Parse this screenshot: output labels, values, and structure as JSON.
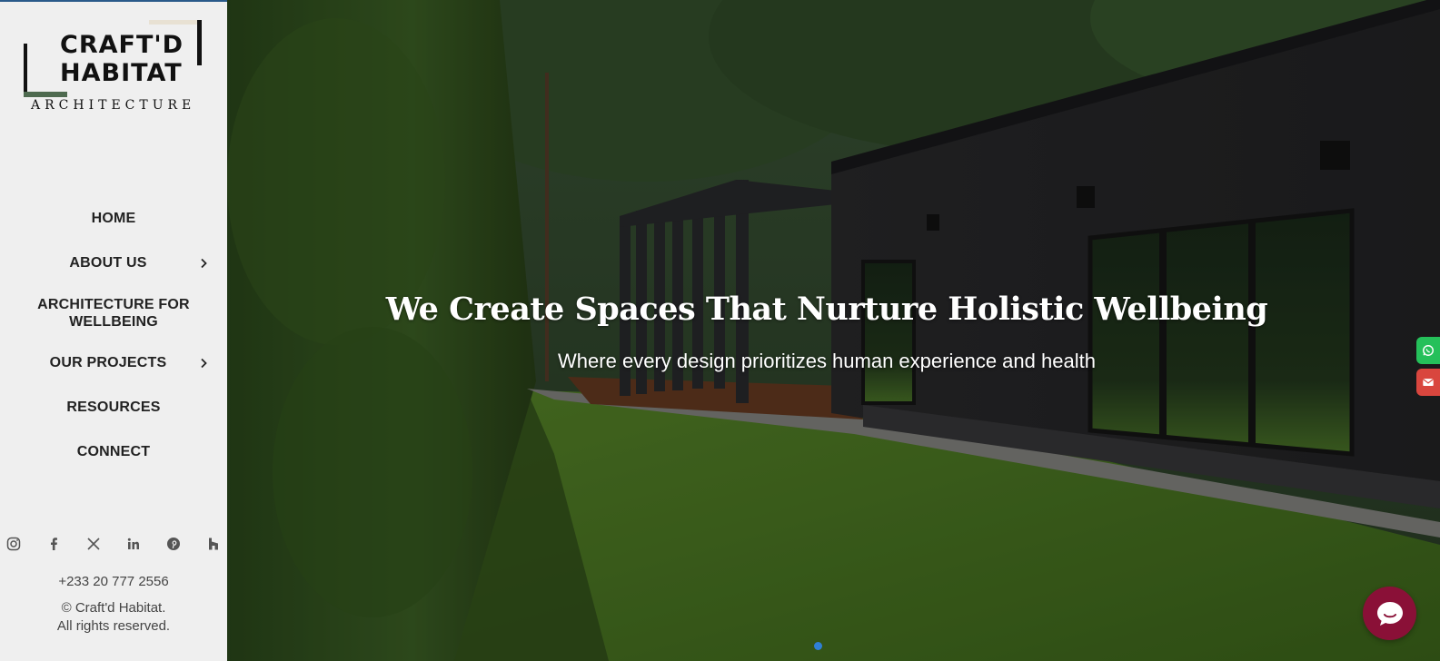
{
  "logo": {
    "line1": "CRAFT'D",
    "line2": "HABITAT",
    "line3": "ARCHITECTURE"
  },
  "nav": {
    "home": "HOME",
    "about": "ABOUT US",
    "architecture": "ARCHITECTURE FOR WELLBEING",
    "projects": "OUR PROJECTS",
    "resources": "RESOURCES",
    "connect": "CONNECT"
  },
  "socials": [
    "instagram-icon",
    "facebook-icon",
    "x-icon",
    "linkedin-icon",
    "pinterest-icon",
    "houzz-icon"
  ],
  "contact": {
    "phone": "+233 20 777 2556",
    "copyright_line1": "© Craft'd Habitat.",
    "copyright_line2": "All rights reserved."
  },
  "hero": {
    "title": "We Create Spaces That Nurture Holistic Wellbeing",
    "subtitle": "Where every design prioritizes human experience and health"
  },
  "colors": {
    "sidebar_bg": "#efefef",
    "logo_green": "#4e6a4f",
    "whatsapp": "#25c05a",
    "email": "#d9463e",
    "chat": "#8a1037",
    "slider_dot": "#2f7fd6"
  }
}
